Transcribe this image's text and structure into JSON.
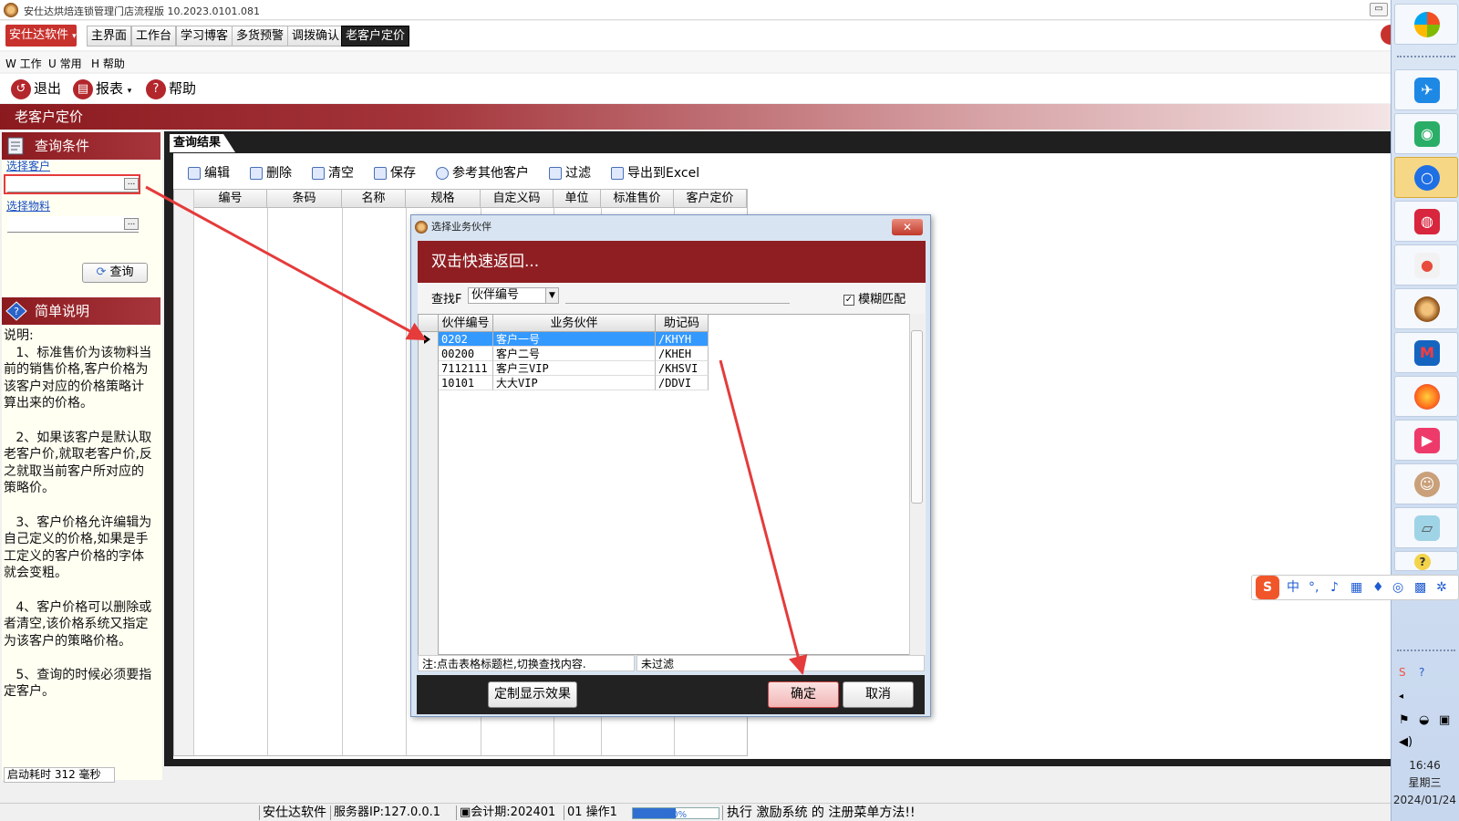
{
  "window": {
    "title": "安仕达烘焙连锁管理门店流程版  10.2023.0101.081",
    "minimize": "▭"
  },
  "brand": "安仕达软件",
  "tabs": [
    {
      "label": "主界面"
    },
    {
      "label": "工作台"
    },
    {
      "label": "学习博客"
    },
    {
      "label": "多货预警"
    },
    {
      "label": "调拨确认"
    },
    {
      "label": "老客户定价"
    }
  ],
  "menu": [
    "W 工作",
    "U 常用",
    "H 帮助"
  ],
  "toolbar": {
    "exit": "退出",
    "report": "报表",
    "help": "帮助"
  },
  "page_title": "老客户定价",
  "left": {
    "query_title": "查询条件",
    "select_customer": "选择客户",
    "select_material": "选择物料",
    "pick_btn": "...",
    "query_btn": "查询",
    "notes_title": "简单说明",
    "notes": "说明:\n   1、标准售价为该物料当前的销售价格,客户价格为该客户对应的价格策略计算出来的价格。\n\n   2、如果该客户是默认取老客户价,就取老客户价,反之就取当前客户所对应的策略价。\n\n   3、客户价格允许编辑为自己定义的价格,如果是手工定义的客户价格的字体就会变粗。\n\n   4、客户价格可以删除或者清空,该价格系统又指定为该客户的策略价格。\n\n   5、查询的时候必须要指定客户。",
    "startup": "启动耗时 312 毫秒"
  },
  "results": {
    "tab": "查询结果",
    "actions": [
      "编辑",
      "删除",
      "清空",
      "保存",
      "参考其他客户",
      "过滤",
      "导出到Excel"
    ],
    "columns": [
      "编号",
      "条码",
      "名称",
      "规格",
      "自定义码",
      "单位",
      "标准售价",
      "客户定价"
    ]
  },
  "dialog": {
    "title": "选择业务伙伴",
    "close": "✕",
    "banner": "双击快速返回...",
    "find_label": "查找F",
    "find_field": "伙伴编号",
    "fuzzy": "模糊匹配",
    "columns": [
      "伙伴编号",
      "业务伙伴",
      "助记码"
    ],
    "rows": [
      [
        "0202",
        "客户一号",
        "/KHYH"
      ],
      [
        "00200",
        "客户二号",
        "/KHEH"
      ],
      [
        "7112111",
        "客户三VIP",
        "/KHSVI"
      ],
      [
        "10101",
        "大大VIP",
        "/DDVI"
      ]
    ],
    "note": "注:点击表格标题栏,切换查找内容.",
    "filter": "未过滤",
    "custom_btn": "定制显示效果",
    "ok_btn": "确定",
    "cancel_btn": "取消"
  },
  "status": {
    "brand": "安仕达软件",
    "server": "服务器IP:127.0.0.1",
    "period": "会计期:202401",
    "operator": "01 操作1",
    "progress_text": "50%",
    "progress": 0.5,
    "message": "执行 激励系统 的 注册菜单方法!!"
  },
  "clock": {
    "time": "16:46",
    "weekday": "星期三",
    "date": "2024/01/24"
  },
  "ime": {
    "lang": "中",
    "punct": "°,"
  },
  "colors": {
    "brand_red": "#8b1a1f",
    "arrow_red": "#e53b3b",
    "selection": "#3399ff"
  }
}
